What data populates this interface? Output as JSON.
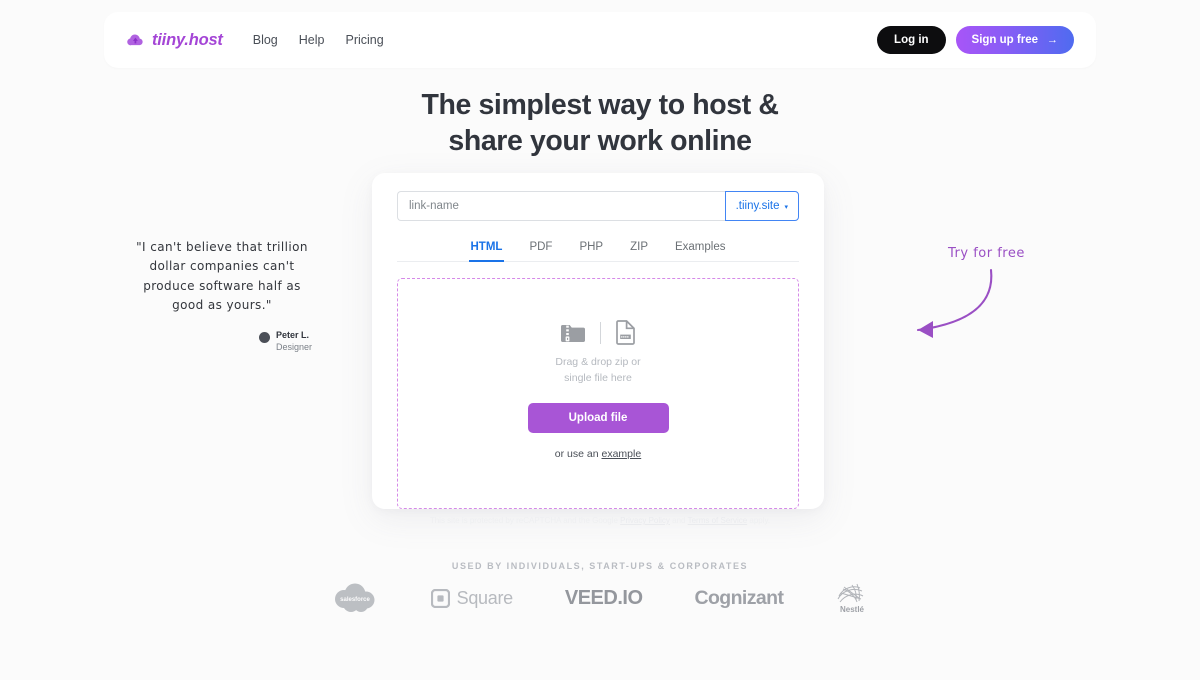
{
  "header": {
    "brand_name": "tiiny.host",
    "logo_icon": "cloud-upload-icon",
    "nav": [
      {
        "label": "Blog"
      },
      {
        "label": "Help"
      },
      {
        "label": "Pricing"
      }
    ],
    "login_label": "Log in",
    "signup_label": "Sign up free",
    "signup_arrow": "→",
    "accent_purple": "#a445d6",
    "signup_gradient_from": "#a855f7",
    "signup_gradient_to": "#4f6bf0",
    "login_bg": "#0d0d0f"
  },
  "hero": {
    "line1": "The simplest way to host &",
    "line2": "share your work online"
  },
  "upload_card": {
    "link_input": {
      "value": "",
      "placeholder": "link-name"
    },
    "domain": {
      "label": ".tiiny.site",
      "caret": "▾",
      "color": "#1a73e8"
    },
    "tabs": [
      {
        "label": "HTML",
        "active": true
      },
      {
        "label": "PDF",
        "active": false
      },
      {
        "label": "PHP",
        "active": false
      },
      {
        "label": "ZIP",
        "active": false
      },
      {
        "label": "Examples",
        "active": false
      }
    ],
    "dropzone": {
      "zip_icon": "zip-folder-icon",
      "file_icon": "html-file-icon",
      "text_line1": "Drag & drop zip or",
      "text_line2": "single file here",
      "border_color": "#d58ae8"
    },
    "upload_button": {
      "label": "Upload file",
      "color": "#a855d6"
    },
    "example_prefix": "or use an ",
    "example_link": "example"
  },
  "recaptcha": {
    "prefix": "This site is protected by reCAPTCHA and the Google ",
    "privacy_policy": "Privacy Policy",
    "middle": " and ",
    "terms": "Terms of Service",
    "suffix": " apply."
  },
  "testimonial": {
    "quote": "\"I can't believe that trillion dollar companies can't produce software half as good as yours.\"",
    "avatar_icon": "user-avatar-icon",
    "name": "Peter L.",
    "role": "Designer"
  },
  "cta_annotation": {
    "text": "Try for free",
    "arrow_icon": "curved-arrow-left-icon",
    "color": "#9a4fc4"
  },
  "social_proof": {
    "heading": "USED BY INDIVIDUALS, START-UPS & CORPORATES",
    "logos": [
      {
        "name": "salesforce-logo",
        "label": "salesforce"
      },
      {
        "name": "square-logo",
        "label": "Square"
      },
      {
        "name": "veed-io-logo",
        "label": "VEED.IO"
      },
      {
        "name": "cognizant-logo",
        "label": "Cognizant"
      },
      {
        "name": "nestle-logo",
        "label": "Nestlé"
      }
    ]
  }
}
